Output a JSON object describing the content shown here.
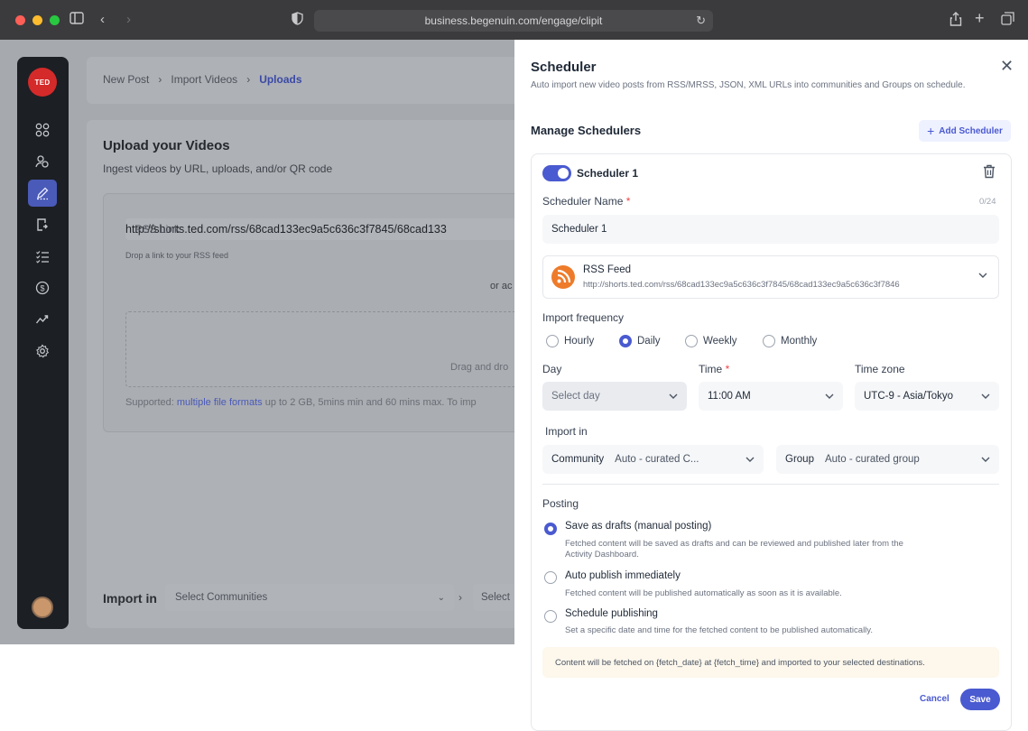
{
  "browser": {
    "url": "business.begenuin.com/engage/clipit"
  },
  "sidebar": {
    "logo": "TED",
    "items": [
      {
        "icon": "grid-icon"
      },
      {
        "icon": "community-icon"
      },
      {
        "icon": "create-post-icon"
      },
      {
        "icon": "import-icon"
      },
      {
        "icon": "checklist-icon"
      },
      {
        "icon": "dollar-icon"
      },
      {
        "icon": "analytics-icon"
      },
      {
        "icon": "settings-icon"
      }
    ]
  },
  "background": {
    "breadcrumbs": [
      "New Post",
      "Import Videos",
      "Uploads"
    ],
    "upload_title": "Upload your Videos",
    "upload_subtitle": "Ingest videos by URL, uploads, and/or QR code",
    "rss_label": "RSS Link",
    "rss_value": "http://shorts.ted.com/rss/68cad133ec9a5c636c3f7845/68cad133",
    "drop_hint": "Drop a link to your RSS feed",
    "or_text": "or ac",
    "drag_text": "Drag and dro",
    "supported_prefix": "Supported: ",
    "supported_link": "multiple file formats",
    "supported_suffix": " up to 2 GB, 5mins min and 60 mins max. To imp",
    "import_in": "Import in",
    "select_communities": "Select Communities",
    "select_group": "Select"
  },
  "panel": {
    "title": "Scheduler",
    "subtitle": "Auto import new video posts from RSS/MRSS, JSON, XML URLs into communities and Groups on schedule.",
    "manage_title": "Manage Schedulers",
    "add_button": "Add Scheduler",
    "scheduler": {
      "enabled": true,
      "title": "Scheduler 1",
      "name_label": "Scheduler Name",
      "name_required": "*",
      "name_counter": "0/24",
      "name_value": "Scheduler 1",
      "feed_name": "RSS Feed",
      "feed_url": "http://shorts.ted.com/rss/68cad133ec9a5c636c3f7845/68cad133ec9a5c636c3f7846",
      "frequency_label": "Import frequency",
      "frequency_options": [
        "Hourly",
        "Daily",
        "Weekly",
        "Monthly"
      ],
      "frequency_selected": "Daily",
      "day_label": "Day",
      "day_placeholder": "Select day",
      "time_label": "Time",
      "time_required": "*",
      "time_value": "11:00 AM",
      "timezone_label": "Time zone",
      "timezone_value": "UTC-9 - Asia/Tokyo",
      "import_in_label": "Import in",
      "community_label": "Community",
      "community_value": "Auto - curated C...",
      "group_label": "Group",
      "group_value": "Auto - curated group",
      "posting_label": "Posting",
      "posting_options": [
        {
          "title": "Save as drafts (manual posting)",
          "desc": "Fetched content will be saved as drafts and can be reviewed and published later from the",
          "desc2": "Activity Dashboard."
        },
        {
          "title": "Auto publish immediately",
          "desc": "Fetched content will be published automatically as soon as it is available.",
          "desc2": ""
        },
        {
          "title": "Schedule publishing",
          "desc": "Set a specific date and time for the fetched content to be published automatically.",
          "desc2": ""
        }
      ],
      "posting_selected": "Save as drafts (manual posting)",
      "notice": "Content will be fetched on {fetch_date} at {fetch_time} and imported to your selected destinations.",
      "cancel": "Cancel",
      "save": "Save"
    }
  },
  "colors": {
    "accent": "#4a5ad0",
    "rss_orange": "#ee7b2a",
    "ted_red": "#d42a2a"
  }
}
